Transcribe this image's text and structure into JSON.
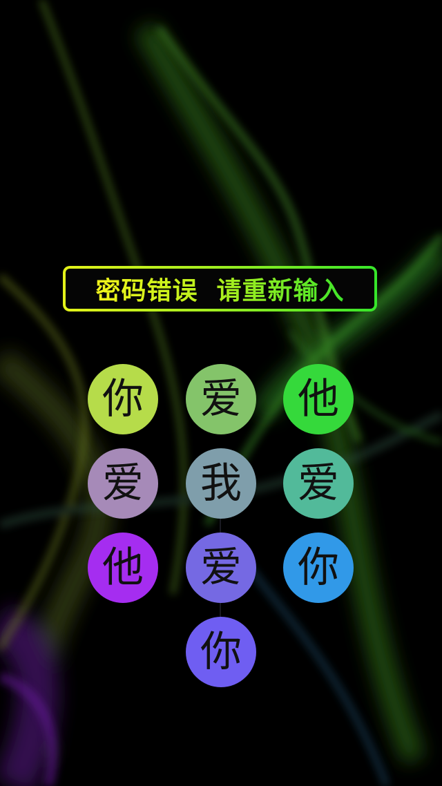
{
  "error": {
    "message": "密码错误  请重新输入"
  },
  "pattern_nodes": [
    {
      "char": "你",
      "color": "#b6dc4a"
    },
    {
      "char": "爱",
      "color": "#84c46a"
    },
    {
      "char": "他",
      "color": "#35d93b"
    },
    {
      "char": "爱",
      "color": "#a68ab8"
    },
    {
      "char": "我",
      "color": "#7f9eab"
    },
    {
      "char": "爱",
      "color": "#52ba9a"
    },
    {
      "char": "他",
      "color": "#a52df0"
    },
    {
      "char": "爱",
      "color": "#7569e3"
    },
    {
      "char": "你",
      "color": "#3199e8"
    },
    {
      "char": "你",
      "color": "#6f5ef2"
    }
  ],
  "theme": {
    "background": "#000000",
    "banner_gradient": [
      "#e4f21a",
      "#36e62a"
    ],
    "glyph_color": "#111111"
  }
}
